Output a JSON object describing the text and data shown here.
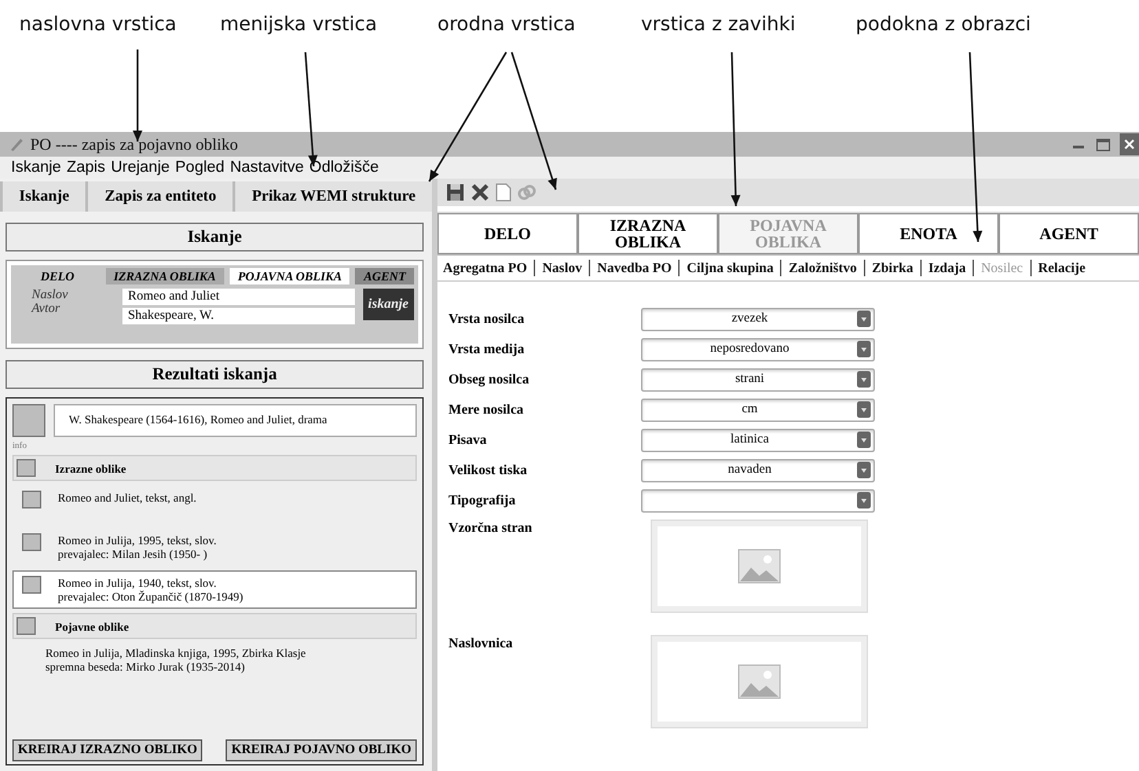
{
  "annotations": [
    {
      "text": "naslovna vrstica"
    },
    {
      "text": "menijska vrstica"
    },
    {
      "text": "orodna vrstica"
    },
    {
      "text": "vrstica z zavihki"
    },
    {
      "text": "podokna z obrazci"
    }
  ],
  "window": {
    "title": "PO ---- zapis za pojavno obliko"
  },
  "menu": [
    "Iskanje",
    "Zapis",
    "Urejanje",
    "Pogled",
    "Nastavitve",
    "Odložišče"
  ],
  "left_tabs": [
    "Iskanje",
    "Zapis za entiteto",
    "Prikaz WEMI strukture"
  ],
  "search": {
    "header": "Iskanje",
    "entity_tabs": [
      {
        "label": "DELO",
        "selected": false
      },
      {
        "label": "IZRAZNA OBLIKA",
        "selected": false
      },
      {
        "label": "POJAVNA OBLIKA",
        "selected": true
      },
      {
        "label": "AGENT",
        "selected": false
      }
    ],
    "fields": [
      {
        "label": "Naslov",
        "value": "Romeo and Juliet"
      },
      {
        "label": "Avtor",
        "value": "Shakespeare, W."
      }
    ],
    "button": "iskanje"
  },
  "results": {
    "header": "Rezultati iskanja",
    "work": "W. Shakespeare (1564-1616), Romeo and Juliet, drama",
    "info": "info",
    "expressions_header": "Izrazne oblike",
    "expressions": [
      {
        "lines": [
          "Romeo and Juliet, tekst, angl."
        ],
        "selected": false
      },
      {
        "lines": [
          "Romeo in Julija, 1995, tekst, slov.",
          "prevajalec: Milan Jesih (1950- )"
        ],
        "selected": false
      },
      {
        "lines": [
          "Romeo in Julija, 1940, tekst, slov.",
          "prevajalec: Oton Župančič (1870-1949)"
        ],
        "selected": true
      }
    ],
    "manifestations_header": "Pojavne oblike",
    "manifestation": [
      "Romeo in Julija, Mladinska knjiga, 1995, Zbirka Klasje",
      "spremna beseda: Mirko Jurak (1935-2014)"
    ],
    "buttons": [
      "KREIRAJ IZRAZNO OBLIKO",
      "KREIRAJ POJAVNO OBLIKO"
    ]
  },
  "entity_tabs": [
    {
      "label": "DELO",
      "selected": false
    },
    {
      "label": "IZRAZNA OBLIKA",
      "selected": false
    },
    {
      "label": "POJAVNA OBLIKA",
      "selected": true
    },
    {
      "label": "ENOTA",
      "selected": false
    },
    {
      "label": "AGENT",
      "selected": false
    }
  ],
  "sub_tabs": [
    {
      "label": "Agregatna PO",
      "selected": false
    },
    {
      "label": "Naslov",
      "selected": false
    },
    {
      "label": "Navedba PO",
      "selected": false
    },
    {
      "label": "Ciljna skupina",
      "selected": false
    },
    {
      "label": "Založništvo",
      "selected": false
    },
    {
      "label": "Zbirka",
      "selected": false
    },
    {
      "label": "Izdaja",
      "selected": false
    },
    {
      "label": "Nosilec",
      "selected": true
    },
    {
      "label": "Relacije",
      "selected": false
    }
  ],
  "form": [
    {
      "kind": "select",
      "label": "Vrsta nosilca",
      "value": "zvezek"
    },
    {
      "kind": "select",
      "label": "Vrsta medija",
      "value": "neposredovano"
    },
    {
      "kind": "select",
      "label": "Obseg nosilca",
      "value": "strani"
    },
    {
      "kind": "select",
      "label": "Mere nosilca",
      "value": "cm"
    },
    {
      "kind": "select",
      "label": "Pisava",
      "value": "latinica"
    },
    {
      "kind": "select",
      "label": "Velikost tiska",
      "value": "navaden"
    },
    {
      "kind": "select",
      "label": "Tipografija"
    },
    {
      "kind": "image",
      "label": "Vzorčna stran"
    },
    {
      "kind": "image",
      "label": "Naslovnica"
    }
  ]
}
